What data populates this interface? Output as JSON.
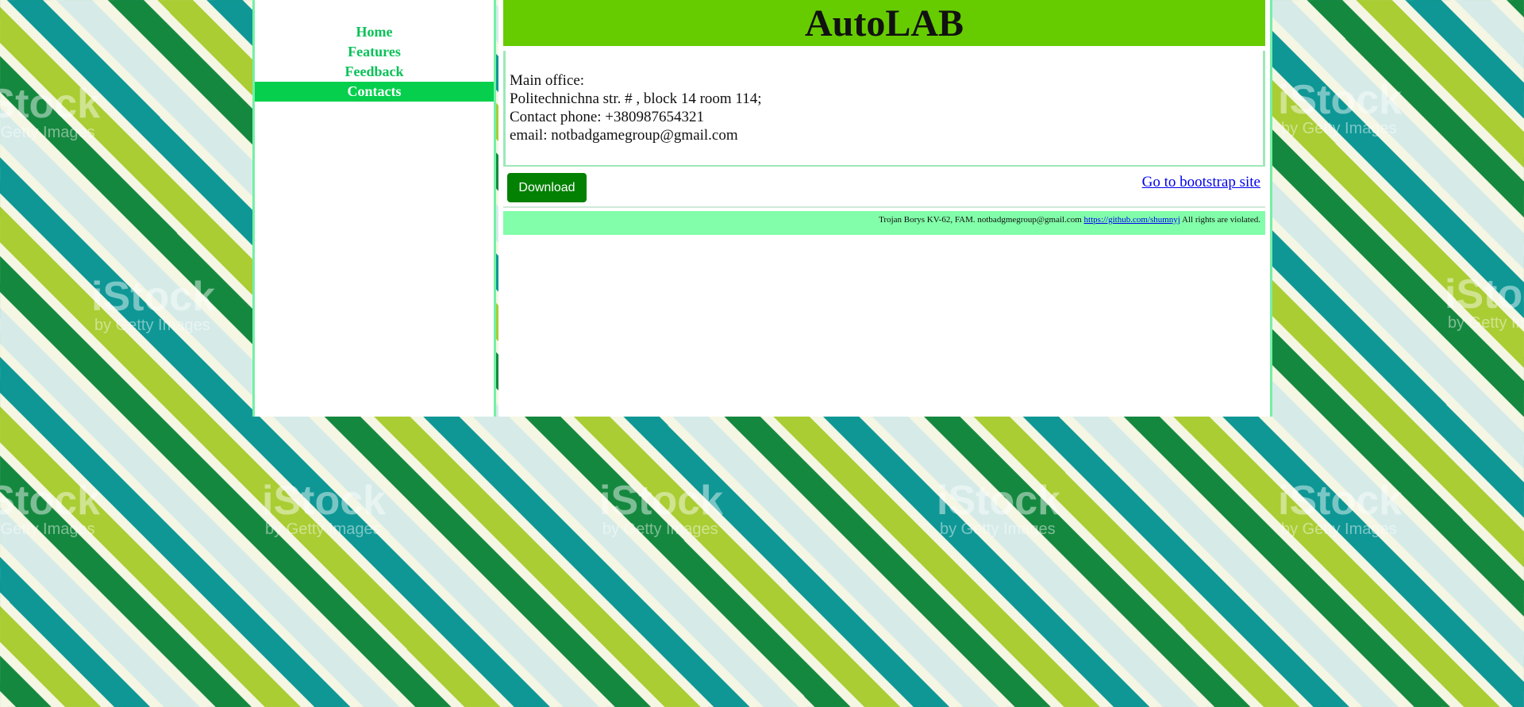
{
  "watermark": {
    "brand": "iStock",
    "sub": "by Getty Images"
  },
  "nav": {
    "items": [
      {
        "label": "Home"
      },
      {
        "label": "Features"
      },
      {
        "label": "Feedback"
      },
      {
        "label": "Contacts"
      }
    ],
    "active": "Contacts"
  },
  "header": {
    "title": "AutoLAB"
  },
  "contacts": {
    "line1": "Main office:",
    "line2": "Politechnichna str. # , block 14 room 114;",
    "line3": "Contact phone: +380987654321",
    "line4": "email: notbadgamegroup@gmail.com"
  },
  "actions": {
    "download_label": "Download",
    "bootstrap_link": "Go to bootstrap site"
  },
  "footer": {
    "text_before": "Trojan Borys KV-62, FAM. notbadgmegroup@gmail.com",
    "link": "https://github.com/shumnyj",
    "text_after": "All rights are violated."
  },
  "colors": {
    "header_bg": "#66cc00",
    "nav_text": "#08c257",
    "nav_active_bg": "#05cf4d",
    "download_bg": "#028102",
    "footer_bg": "#82fda9",
    "border": "#74f0a4"
  }
}
